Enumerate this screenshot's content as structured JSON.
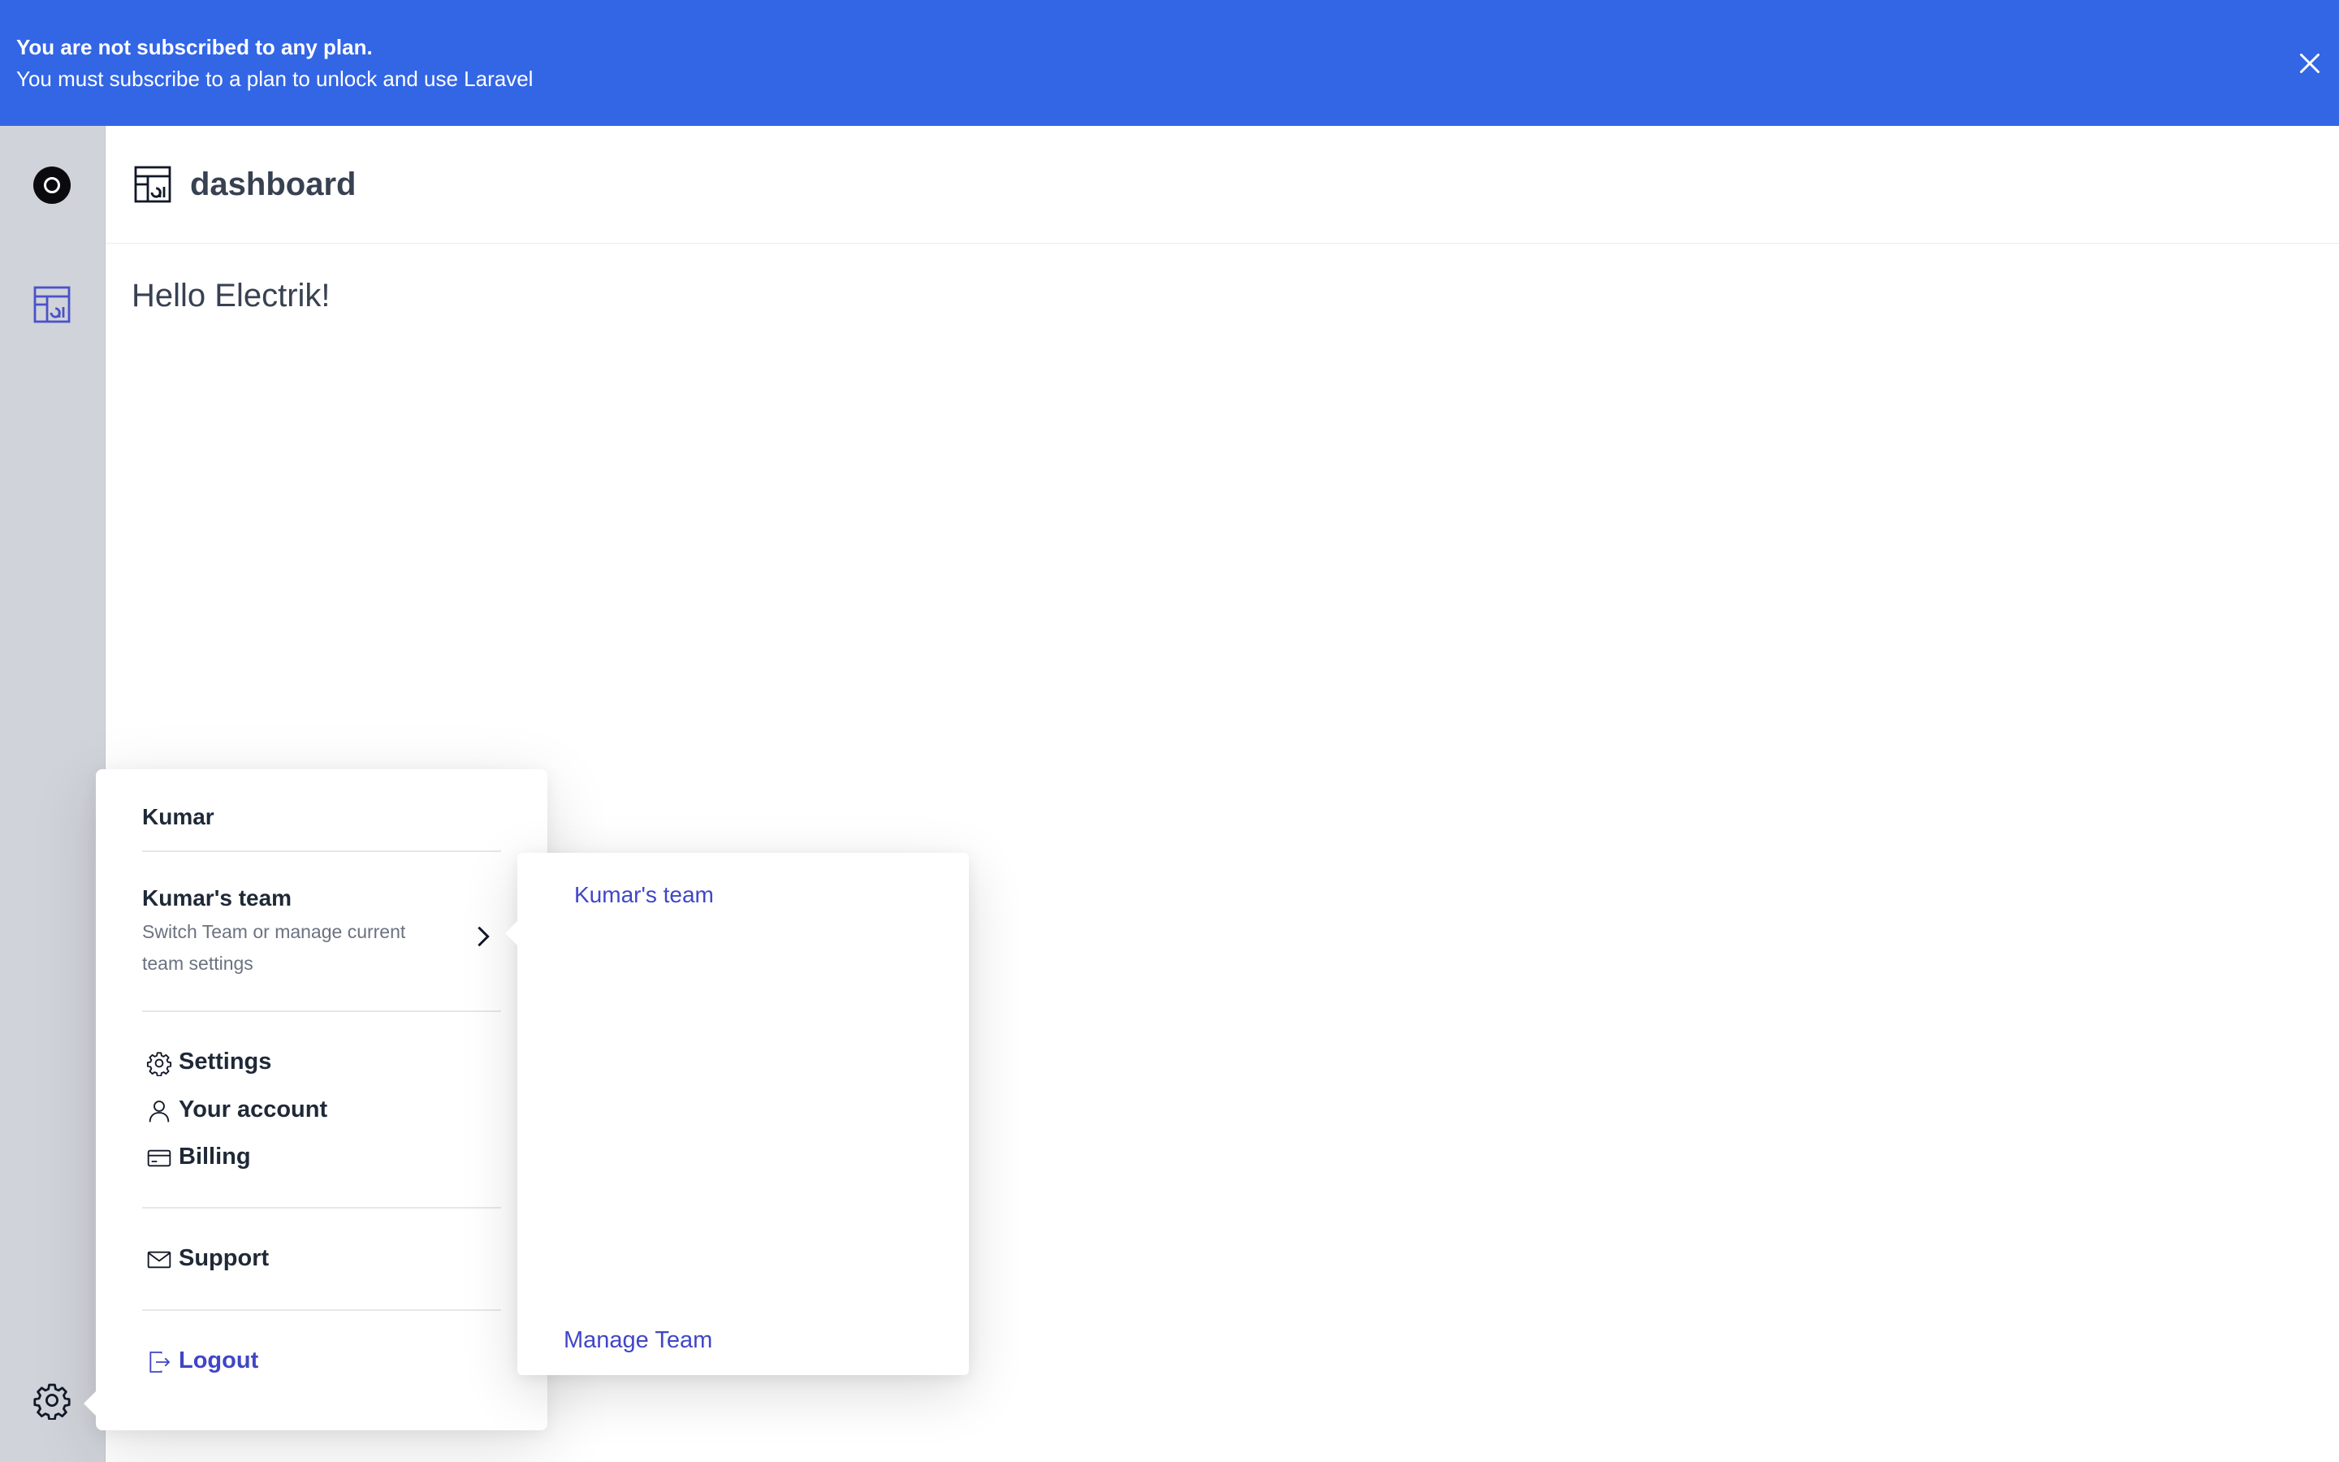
{
  "banner": {
    "title": "You are not subscribed to any plan.",
    "message": "You must subscribe to a plan to unlock and use Laravel",
    "close_icon": "close-icon",
    "background": "#3366e5"
  },
  "sidebar": {
    "logo_icon": "logo-icon",
    "nav_icon": "dashboard-icon",
    "settings_icon": "gear-icon",
    "accent": "#4b52c9"
  },
  "header": {
    "title": "dashboard",
    "icon": "dashboard-icon"
  },
  "main": {
    "greeting": "Hello Electrik!"
  },
  "user_menu": {
    "user_name": "Kumar",
    "team": {
      "name": "Kumar's team",
      "description": "Switch Team or manage current team settings"
    },
    "items": [
      {
        "label": "Settings",
        "icon": "gear-icon"
      },
      {
        "label": "Your account",
        "icon": "user-icon"
      },
      {
        "label": "Billing",
        "icon": "credit-card-icon"
      }
    ],
    "support": {
      "label": "Support",
      "icon": "mail-icon"
    },
    "logout": {
      "label": "Logout",
      "icon": "logout-icon"
    }
  },
  "team_submenu": {
    "teams": [
      "Kumar's team"
    ],
    "manage_label": "Manage Team",
    "link_color": "#4046c7"
  }
}
